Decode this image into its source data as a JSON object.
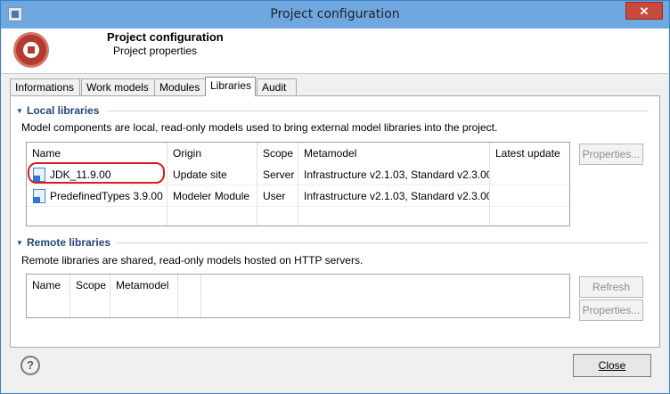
{
  "window": {
    "title": "Project configuration",
    "close_glyph": "✕"
  },
  "banner": {
    "title": "Project configuration",
    "subtitle": "Project properties"
  },
  "tabs": [
    {
      "label": "Informations"
    },
    {
      "label": "Work models"
    },
    {
      "label": "Modules"
    },
    {
      "label": "Libraries",
      "active": true
    },
    {
      "label": "Audit"
    }
  ],
  "local": {
    "heading": "Local libraries",
    "description": "Model components are local, read-only models used to bring external model libraries into the project.",
    "columns": [
      "Name",
      "Origin",
      "Scope",
      "Metamodel",
      "Latest update"
    ],
    "rows": [
      {
        "name": "JDK_11.9.00",
        "origin": "Update site",
        "scope": "Server",
        "metamodel": "Infrastructure v2.1.03, Standard v2.3.00",
        "latest": ""
      },
      {
        "name": "PredefinedTypes 3.9.00",
        "origin": "Modeler Module",
        "scope": "User",
        "metamodel": "Infrastructure v2.1.03, Standard v2.3.00",
        "latest": ""
      }
    ],
    "properties_button": "Properties..."
  },
  "remote": {
    "heading": "Remote libraries",
    "description": "Remote libraries are shared, read-only models hosted on HTTP servers.",
    "columns": [
      "Name",
      "Scope",
      "Metamodel"
    ],
    "refresh_button": "Refresh",
    "properties_button": "Properties..."
  },
  "footer": {
    "help_glyph": "?",
    "close_button": "Close"
  },
  "colors": {
    "accent": "#23457a",
    "highlight": "#d21f1f",
    "titlebar": "#6fa8e0"
  }
}
